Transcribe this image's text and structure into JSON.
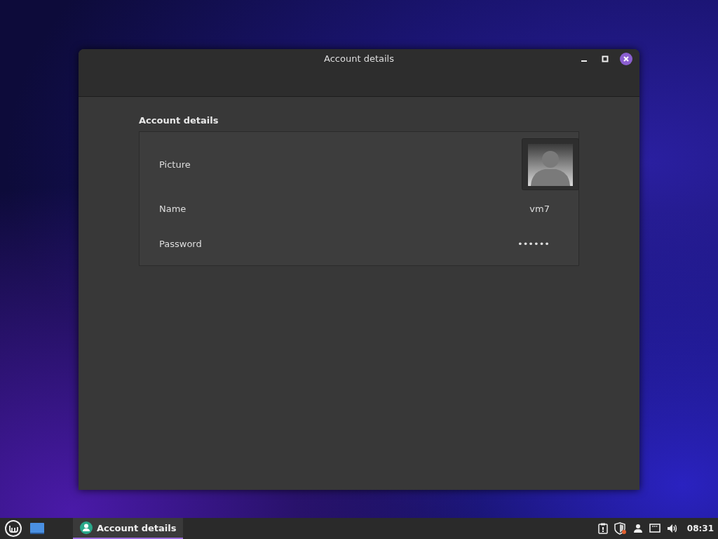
{
  "window": {
    "title": "Account details"
  },
  "section": {
    "title": "Account details",
    "rows": [
      {
        "kind": "picture",
        "label": "Picture"
      },
      {
        "kind": "text",
        "label": "Name",
        "value": "vm7"
      },
      {
        "kind": "text",
        "label": "Password",
        "value": "••••••"
      }
    ]
  },
  "taskbar": {
    "windows": [
      {
        "label": "Account details",
        "selected": true
      }
    ],
    "clock": "08:31"
  }
}
